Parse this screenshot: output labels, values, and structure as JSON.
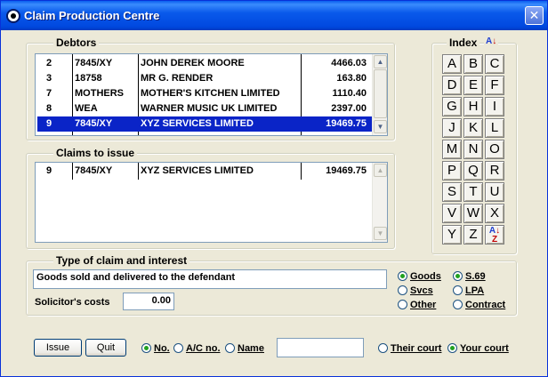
{
  "window": {
    "title": "Claim Production Centre",
    "close_glyph": "✕",
    "icon": "app-lifebuoy-icon"
  },
  "debtors": {
    "label": "Debtors",
    "rows": [
      {
        "no": "2",
        "ref": "7845/XY",
        "name": "JOHN DEREK MOORE",
        "amount": "4466.03",
        "selected": false
      },
      {
        "no": "3",
        "ref": "18758",
        "name": "MR G. RENDER",
        "amount": "163.80",
        "selected": false
      },
      {
        "no": "7",
        "ref": "MOTHERS",
        "name": "MOTHER'S KITCHEN LIMITED",
        "amount": "1110.40",
        "selected": false
      },
      {
        "no": "8",
        "ref": "WEA",
        "name": "WARNER MUSIC UK LIMITED",
        "amount": "2397.00",
        "selected": false
      },
      {
        "no": "9",
        "ref": "7845/XY",
        "name": "XYZ SERVICES LIMITED",
        "amount": "19469.75",
        "selected": true
      }
    ]
  },
  "claims": {
    "label": "Claims to issue",
    "rows": [
      {
        "no": "9",
        "ref": "7845/XY",
        "name": "XYZ SERVICES LIMITED",
        "amount": "19469.75"
      }
    ]
  },
  "index": {
    "label": "Index",
    "sort_icon": "sort-az-icon",
    "letters": [
      "A",
      "B",
      "C",
      "D",
      "E",
      "F",
      "G",
      "H",
      "I",
      "J",
      "K",
      "L",
      "M",
      "N",
      "O",
      "P",
      "Q",
      "R",
      "S",
      "T",
      "U",
      "V",
      "W",
      "X",
      "Y",
      "Z"
    ]
  },
  "claim_type": {
    "label": "Type of claim and interest",
    "description": "Goods sold and delivered to the defendant",
    "costs_label": "Solicitor's costs",
    "costs_value": "0.00",
    "type_options": [
      {
        "label": "Goods",
        "selected": true
      },
      {
        "label": "Svcs",
        "selected": false
      },
      {
        "label": "Other",
        "selected": false
      }
    ],
    "interest_options": [
      {
        "label": "S.69",
        "selected": true
      },
      {
        "label": "LPA",
        "selected": false
      },
      {
        "label": "Contract",
        "selected": false
      }
    ]
  },
  "footer": {
    "issue_label": "Issue",
    "quit_label": "Quit",
    "search_options": [
      {
        "label": "No.",
        "selected": true
      },
      {
        "label": "A/C no.",
        "selected": false
      },
      {
        "label": "Name",
        "selected": false
      }
    ],
    "search_value": "",
    "court_options": [
      {
        "label": "Their court",
        "selected": false
      },
      {
        "label": "Your court",
        "selected": true
      }
    ]
  }
}
